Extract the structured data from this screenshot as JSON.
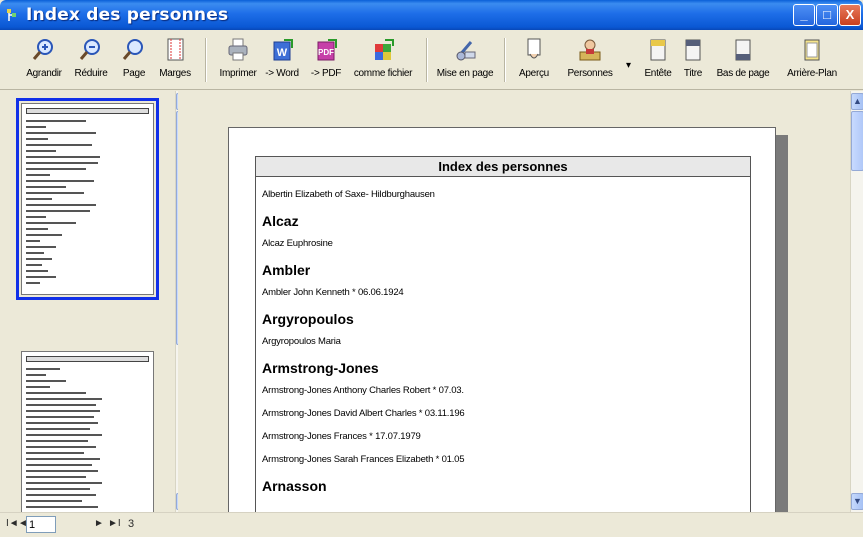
{
  "window": {
    "title": "Index des personnes",
    "controls": {
      "minimize": "_",
      "maximize": "□",
      "close": "X"
    }
  },
  "toolbar": {
    "items": [
      {
        "label": "Agrandir",
        "icon": "zoom-in-icon"
      },
      {
        "label": "Réduire",
        "icon": "zoom-out-icon"
      },
      {
        "label": "Page",
        "icon": "zoom-page-icon"
      },
      {
        "label": "Marges",
        "icon": "margins-icon"
      },
      {
        "label": "Imprimer",
        "icon": "printer-icon"
      },
      {
        "label": "-> Word",
        "icon": "word-export-icon"
      },
      {
        "label": "-> PDF",
        "icon": "pdf-export-icon"
      },
      {
        "label": "comme fichier",
        "icon": "file-export-icon"
      },
      {
        "label": "Mise en page",
        "icon": "page-setup-icon"
      },
      {
        "label": "Aperçu",
        "icon": "preview-icon"
      },
      {
        "label": "Personnes",
        "icon": "persons-icon"
      },
      {
        "label": "Entête",
        "icon": "header-icon"
      },
      {
        "label": "Titre",
        "icon": "title-icon"
      },
      {
        "label": "Bas de page",
        "icon": "footer-icon"
      },
      {
        "label": "Arrière-Plan",
        "icon": "background-icon"
      }
    ]
  },
  "document": {
    "header": "Index des personnes",
    "rows": [
      {
        "type": "entry",
        "text": "Albertin Elizabeth of Saxe- Hildburghausen"
      },
      {
        "type": "group",
        "text": "Alcaz"
      },
      {
        "type": "entry",
        "text": "Alcaz Euphrosine"
      },
      {
        "type": "group",
        "text": "Ambler"
      },
      {
        "type": "entry",
        "text": "Ambler John Kenneth * 06.06.1924"
      },
      {
        "type": "group",
        "text": "Argyropoulos"
      },
      {
        "type": "entry",
        "text": "Argyropoulos Maria"
      },
      {
        "type": "group",
        "text": "Armstrong-Jones"
      },
      {
        "type": "entry",
        "text": "Armstrong-Jones Anthony Charles Robert * 07.03."
      },
      {
        "type": "entry",
        "text": "Armstrong-Jones David Albert Charles * 03.11.196"
      },
      {
        "type": "entry",
        "text": "Armstrong-Jones Frances * 17.07.1979"
      },
      {
        "type": "entry",
        "text": "Armstrong-Jones Sarah Frances Elizabeth * 01.05"
      },
      {
        "type": "group",
        "text": "Arnasson"
      }
    ]
  },
  "statusbar": {
    "first": "I◄",
    "prev": "◄",
    "page_value": "1",
    "next": "►",
    "last": "►I",
    "page_count": "3"
  }
}
